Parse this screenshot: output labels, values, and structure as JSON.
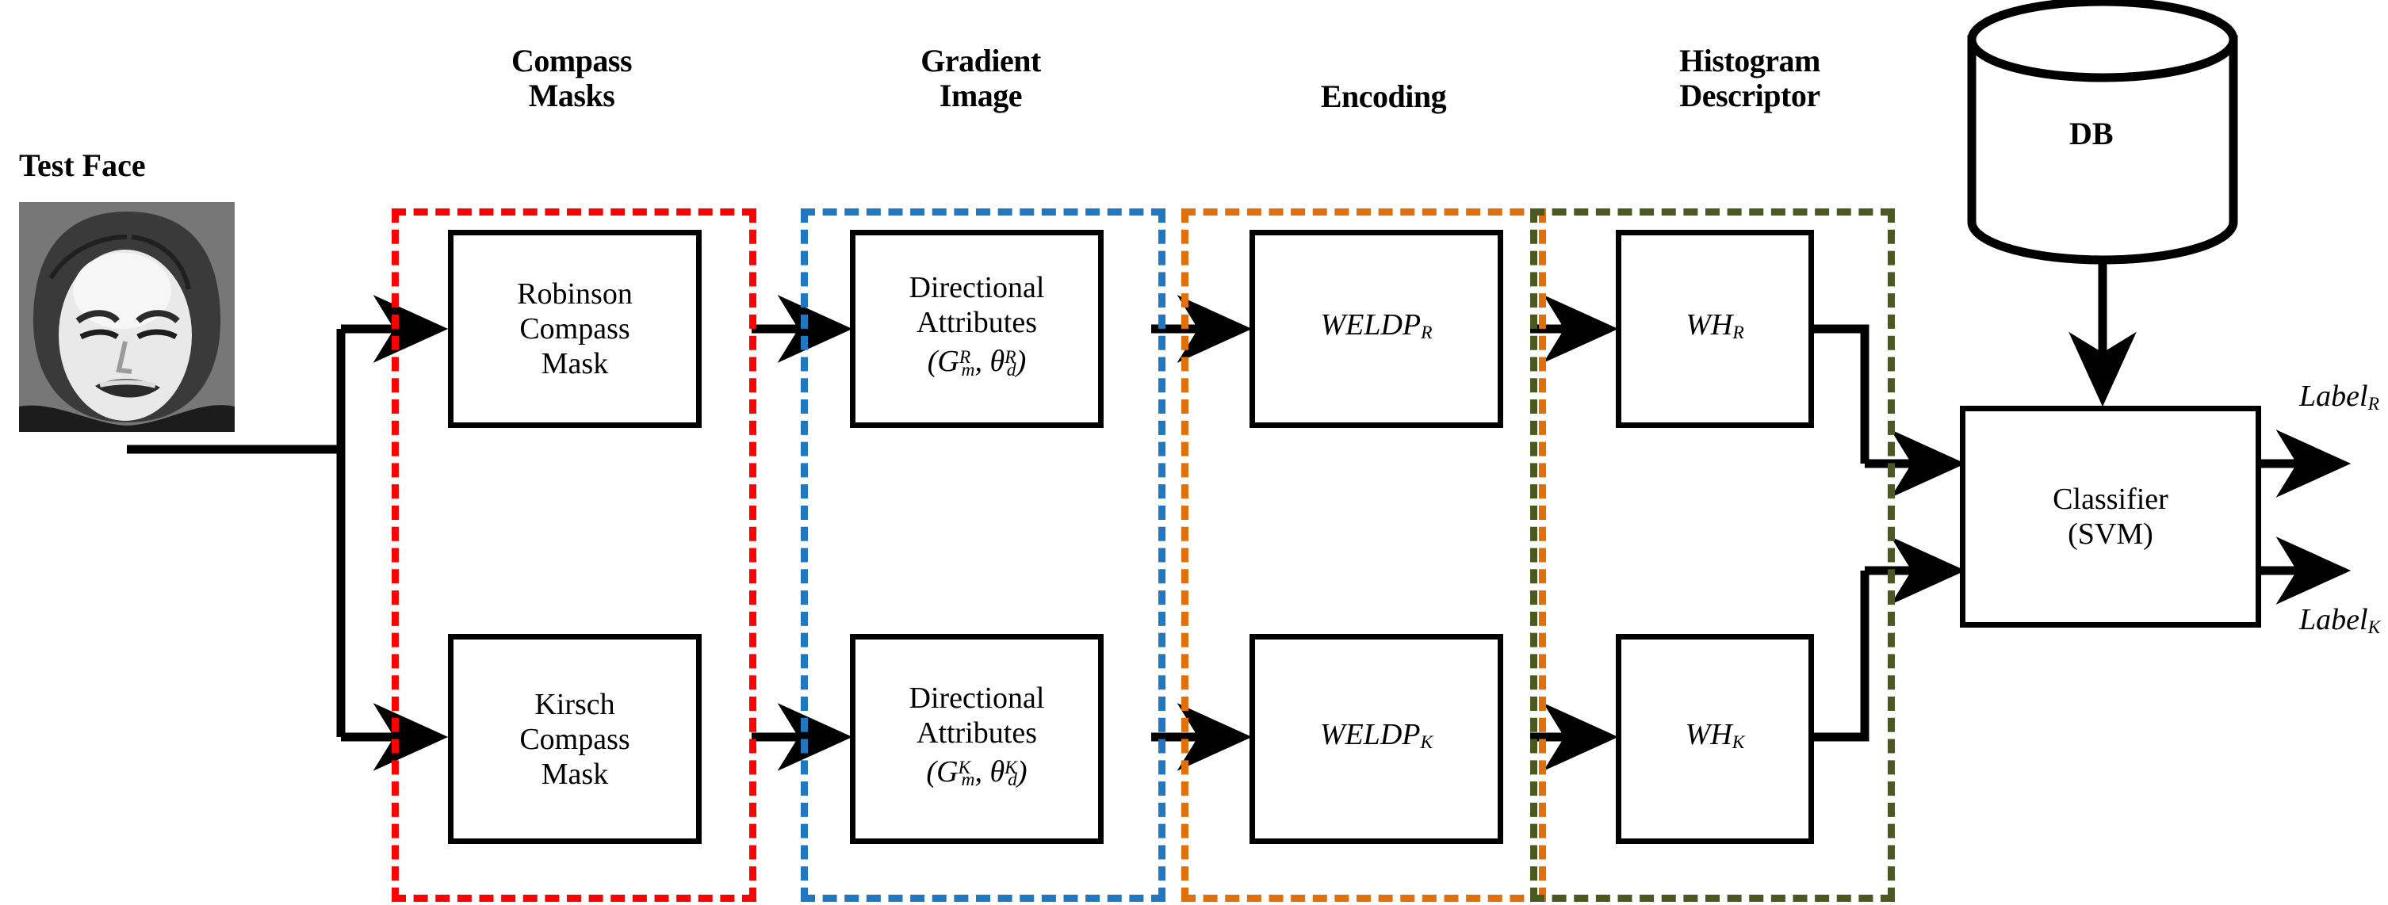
{
  "diagram": {
    "title": "WELDP face expression recognition pipeline",
    "columns": [
      {
        "key": "compass_masks",
        "header_line1": "Compass",
        "header_line2": "Masks",
        "accent": "#ff0000"
      },
      {
        "key": "gradient_image",
        "header_line1": "Gradient",
        "header_line2": "Image",
        "accent": "#1f78c1"
      },
      {
        "key": "encoding",
        "header_line1": "Encoding",
        "header_line2": "",
        "accent": "#e2700a"
      },
      {
        "key": "histogram_descriptor",
        "header_line1": "Histogram",
        "header_line2": "Descriptor",
        "accent": "#4a5a1e"
      }
    ],
    "input": {
      "label": "Test Face",
      "image_alt": "grayscale photo of a woman with a disgust facial expression"
    },
    "rows": [
      {
        "key": "robinson",
        "mask_line1": "Robinson",
        "mask_line2": "Compass",
        "mask_line3": "Mask",
        "attr_line1": "Directional",
        "attr_line2": "Attributes",
        "attr_math_open": "(",
        "attr_math_G": "G",
        "attr_math_G_sub": "m",
        "attr_math_G_sup": "R",
        "attr_math_comma": ", ",
        "attr_math_theta": "θ",
        "attr_math_theta_sub": "d",
        "attr_math_theta_sup": "R",
        "attr_math_close": ")",
        "encoding_base": "WELDP",
        "encoding_sub": "R",
        "histogram_base": "WH",
        "histogram_sub": "R",
        "output_base": "Label",
        "output_sub": "R"
      },
      {
        "key": "kirsch",
        "mask_line1": "Kirsch",
        "mask_line2": "Compass",
        "mask_line3": "Mask",
        "attr_line1": "Directional",
        "attr_line2": "Attributes",
        "attr_math_open": "(",
        "attr_math_G": "G",
        "attr_math_G_sub": "m",
        "attr_math_G_sup": "K",
        "attr_math_comma": ", ",
        "attr_math_theta": "θ",
        "attr_math_theta_sub": "d",
        "attr_math_theta_sup": "K",
        "attr_math_close": ")",
        "encoding_base": "WELDP",
        "encoding_sub": "K",
        "histogram_base": "WH",
        "histogram_sub": "K",
        "output_base": "Label",
        "output_sub": "K"
      }
    ],
    "database": {
      "label": "DB"
    },
    "classifier": {
      "line1": "Classifier",
      "line2": "(SVM)"
    },
    "colors": {
      "compass_masks": "#ff0000",
      "gradient_image": "#1f78c1",
      "encoding": "#e2700a",
      "histogram_descriptor": "#4a5a1e",
      "stroke": "#000000",
      "background": "#ffffff"
    }
  }
}
